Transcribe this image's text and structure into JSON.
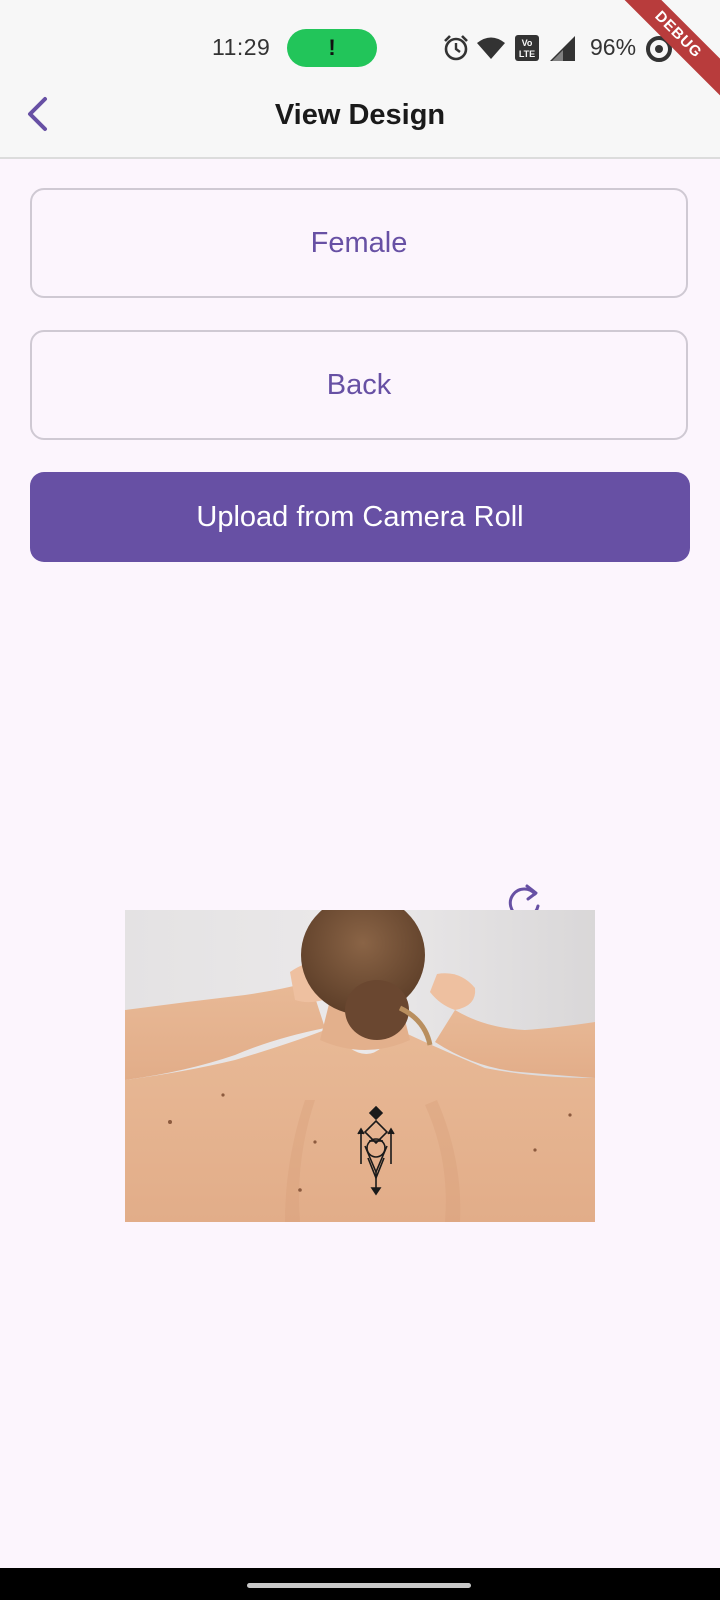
{
  "status_bar": {
    "time": "11:29",
    "notification_mark": "!",
    "battery": "96%",
    "icons": [
      "alarm-icon",
      "wifi-icon",
      "volte-icon",
      "signal-icon",
      "battery-saver-icon"
    ]
  },
  "debug_banner": "DEBUG",
  "app_bar": {
    "title": "View Design",
    "back_icon": "chevron-left-icon"
  },
  "buttons": {
    "gender_label": "Female",
    "side_label": "Back",
    "upload_label": "Upload from Camera Roll"
  },
  "preview": {
    "refresh_icon": "refresh-icon",
    "image_subject": "woman's back with geometric tattoo"
  },
  "colors": {
    "accent": "#6750a4",
    "background": "#fcf5fd",
    "debug_ribbon": "#b83c3c",
    "status_pill": "#22c55a"
  }
}
